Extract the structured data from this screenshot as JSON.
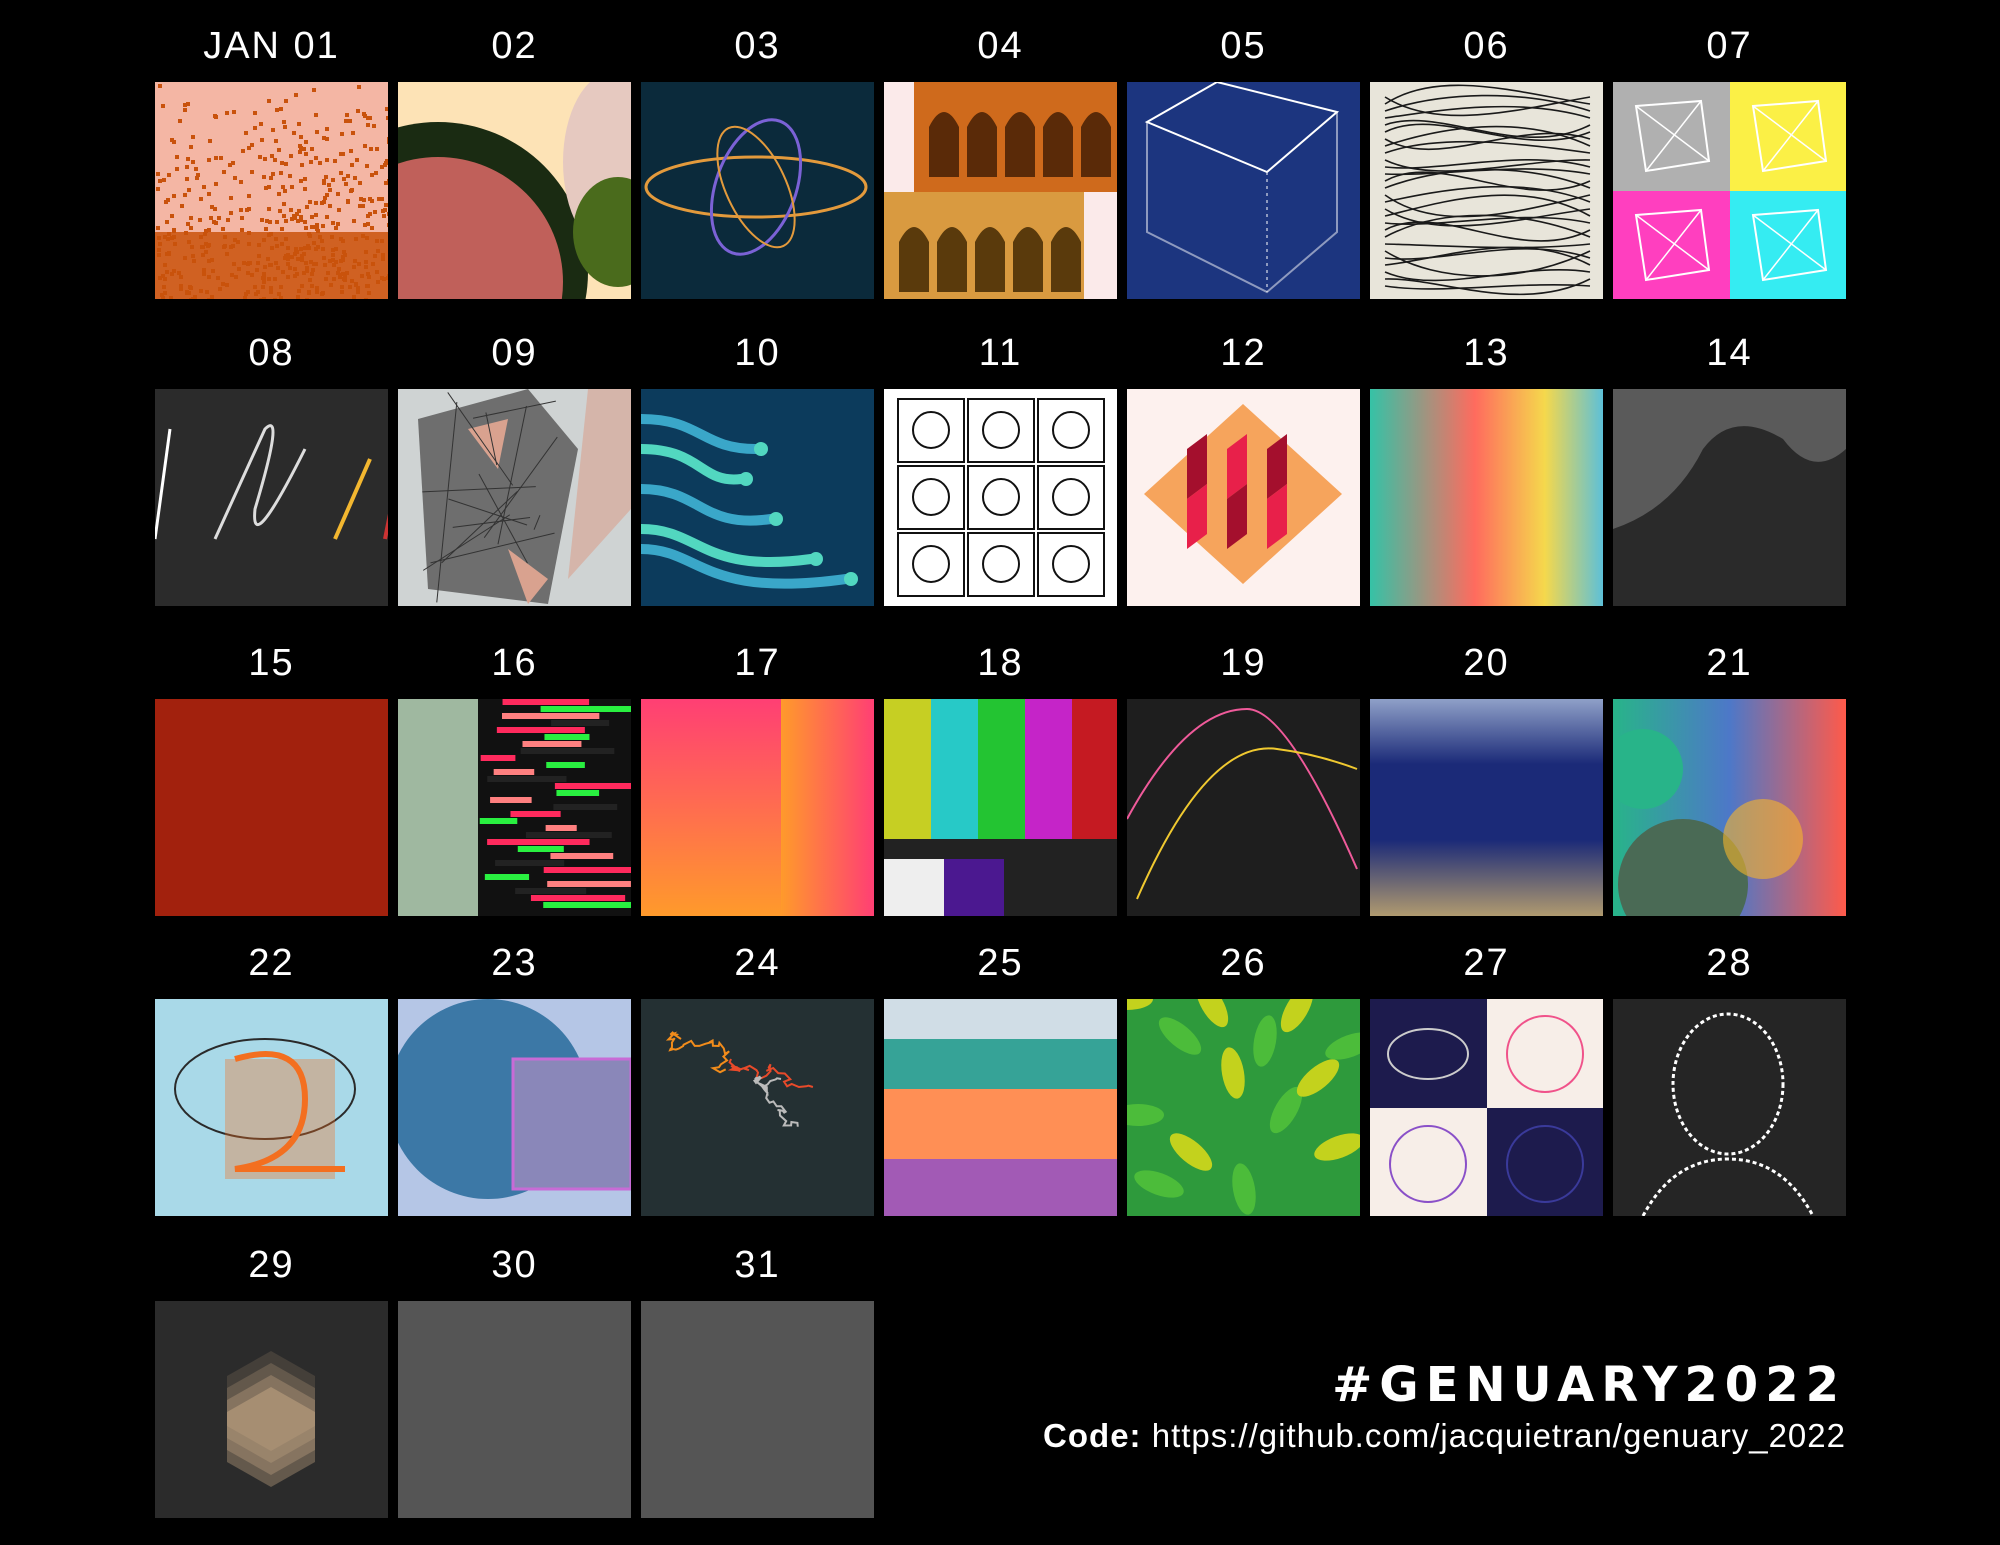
{
  "days": [
    {
      "label": "JAN 01",
      "art": "pixel-noise-orange",
      "colors": [
        "#f4b6a4",
        "#c9520c"
      ]
    },
    {
      "label": "02",
      "art": "shapes-dither",
      "colors": [
        "#fde3b6",
        "#c0605a",
        "#1a2b12",
        "#4a6b1c"
      ]
    },
    {
      "label": "03",
      "art": "orbit-rings",
      "colors": [
        "#0b2a3b",
        "#e39a3c",
        "#7b62d6"
      ]
    },
    {
      "label": "04",
      "art": "arches",
      "colors": [
        "#cf6a1c",
        "#d99a40",
        "#fbeaea"
      ]
    },
    {
      "label": "05",
      "art": "isometric-box",
      "colors": [
        "#1c357f",
        "#ffffff"
      ]
    },
    {
      "label": "06",
      "art": "flow-field",
      "colors": [
        "#e8e5da",
        "#1a1a1a"
      ]
    },
    {
      "label": "07",
      "art": "mesh-quadrants",
      "colors": [
        "#b0b0b0",
        "#fbf046",
        "#ff3fbf",
        "#35ecf2"
      ]
    },
    {
      "label": "08",
      "art": "scribbles",
      "colors": [
        "#2b2b2b",
        "#ffffff",
        "#f3b730"
      ]
    },
    {
      "label": "09",
      "art": "triangulation",
      "colors": [
        "#6e6e6e",
        "#d9a28f",
        "#cfd3d3"
      ]
    },
    {
      "label": "10",
      "art": "branches",
      "colors": [
        "#0c3b5c",
        "#3aa7c9",
        "#52d7c0"
      ]
    },
    {
      "label": "11",
      "art": "doodle-grid",
      "colors": [
        "#ffffff",
        "#111111"
      ]
    },
    {
      "label": "12",
      "art": "cubes",
      "colors": [
        "#fdf1ee",
        "#e8204a",
        "#f6a45c",
        "#a40f2d"
      ]
    },
    {
      "label": "13",
      "art": "gradient-blur",
      "colors": [
        "#35c2a6",
        "#ff6b5e",
        "#f5d84c",
        "#5dc0d8"
      ]
    },
    {
      "label": "14",
      "art": "terrain",
      "colors": [
        "#2a2a2a",
        "#5a5a5a"
      ]
    },
    {
      "label": "15",
      "art": "red-texture",
      "colors": [
        "#a2210d"
      ]
    },
    {
      "label": "16",
      "art": "glitch",
      "colors": [
        "#ff2a5d",
        "#29f040",
        "#111111",
        "#9fb8a0"
      ]
    },
    {
      "label": "17",
      "art": "sunset-gradient",
      "colors": [
        "#ff3f74",
        "#ff9a2b",
        "#ffc51a"
      ]
    },
    {
      "label": "18",
      "art": "test-pattern",
      "colors": [
        "#c6cf23",
        "#27c9c7",
        "#23c432",
        "#c524c8",
        "#c51a22"
      ]
    },
    {
      "label": "19",
      "art": "text-curves",
      "colors": [
        "#1e1e1e",
        "#ef5a9a",
        "#f0c930"
      ]
    },
    {
      "label": "20",
      "art": "noise-horizon",
      "colors": [
        "#1b2a78",
        "#8fa0c8",
        "#b09a6f"
      ]
    },
    {
      "label": "21",
      "art": "circles-gradient",
      "colors": [
        "#28b489",
        "#ff5a4a",
        "#4d78c8",
        "#f7b52b"
      ]
    },
    {
      "label": "22",
      "art": "swirl-2",
      "colors": [
        "#a9d9e8",
        "#f36f20",
        "#2a2a2a"
      ]
    },
    {
      "label": "23",
      "art": "circles-squares",
      "colors": [
        "#b5c6e6",
        "#3c78a6",
        "#8a87b9"
      ]
    },
    {
      "label": "24",
      "art": "random-walk",
      "colors": [
        "#243033",
        "#f28c1b",
        "#e84a2a"
      ]
    },
    {
      "label": "25",
      "art": "landscape-bands",
      "colors": [
        "#d0dde6",
        "#36a397",
        "#ff8f55",
        "#a25ab5"
      ]
    },
    {
      "label": "26",
      "art": "leaves",
      "colors": [
        "#2e9a3c",
        "#4cbc3a",
        "#c3d21d"
      ]
    },
    {
      "label": "27",
      "art": "attractors",
      "colors": [
        "#1d1b4d",
        "#f7eee8",
        "#f0528a",
        "#8a50c8"
      ]
    },
    {
      "label": "28",
      "art": "portrait-lines",
      "colors": [
        "#252525",
        "#ffffff"
      ]
    },
    {
      "label": "29",
      "art": "hexagons",
      "colors": [
        "#2b2b2b",
        "#ffd7a8"
      ]
    },
    {
      "label": "30",
      "art": "empty",
      "colors": [
        "#555555"
      ]
    },
    {
      "label": "31",
      "art": "empty",
      "colors": [
        "#555555"
      ]
    }
  ],
  "footer": {
    "hashtag": "#GENUARY2022",
    "code_label": "Code:",
    "code_url": "https://github.com/jacquietran/genuary_2022"
  }
}
